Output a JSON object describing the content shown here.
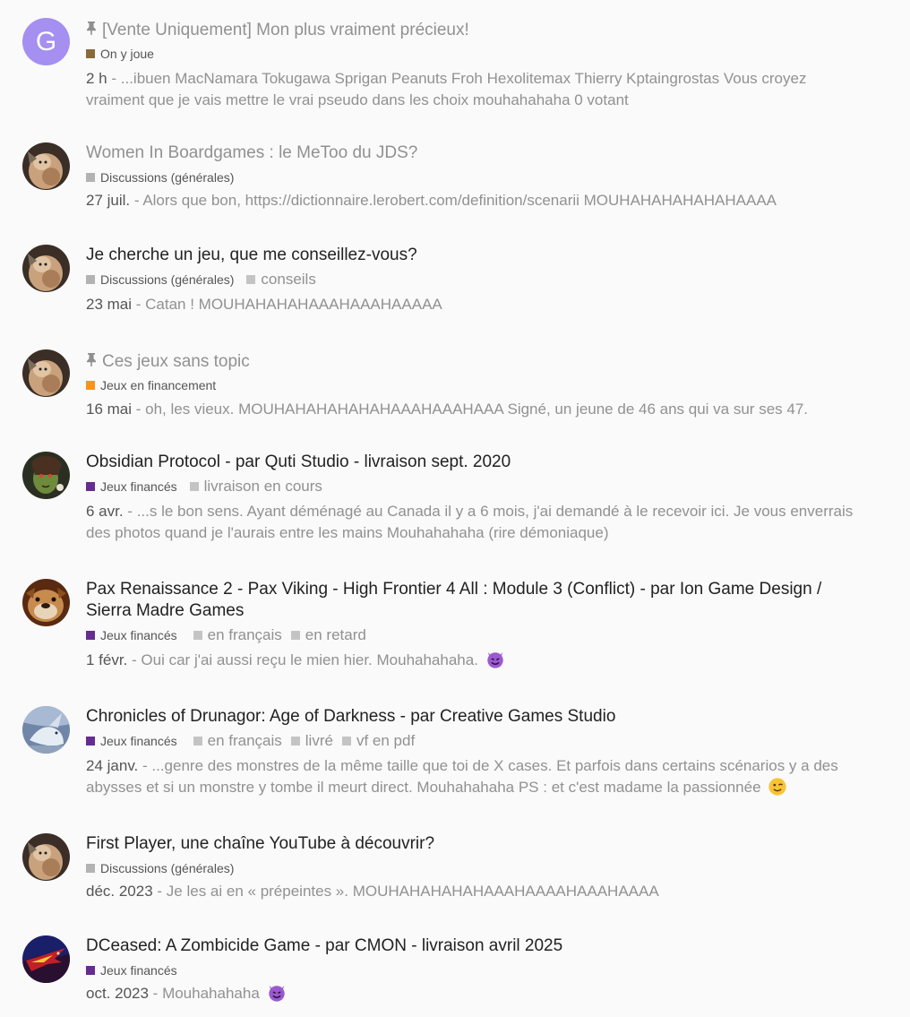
{
  "results": [
    {
      "avatar_letter": "G",
      "pinned": true,
      "title": "[Vente Uniquement] Mon plus vraiment précieux!",
      "visited": true,
      "category": {
        "label": "On y joue",
        "color": "#8a6a3b"
      },
      "tags": [],
      "date": "2 h",
      "excerpt": "...ibuen MacNamara Tokugawa Sprigan Peanuts Froh Hexolitemax Thierry Kptaingrostas Vous croyez vraiment que je vais mettre le vrai pseudo dans les choix mouhahahaha 0 votant"
    },
    {
      "avatar": "cat-avatar",
      "pinned": false,
      "title": "Women In Boardgames : le MeToo du JDS?",
      "visited": true,
      "category": {
        "label": "Discussions (générales)",
        "color": "#b3b3b3"
      },
      "tags": [],
      "date": "27 juil.",
      "excerpt": "Alors que bon, https://dictionnaire.lerobert.com/definition/scenarii MOUHAHAHAHAHAHAAAA"
    },
    {
      "avatar": "cat-avatar",
      "pinned": false,
      "title": "Je cherche un jeu, que me conseillez-vous?",
      "visited": false,
      "category": {
        "label": "Discussions (générales)",
        "color": "#b3b3b3"
      },
      "tags": [
        "conseils"
      ],
      "date": "23 mai",
      "excerpt": "Catan ! MOUHAHAHAHAAAHAAAHAAAAA"
    },
    {
      "avatar": "cat-avatar",
      "pinned": true,
      "title": "Ces jeux sans topic",
      "visited": true,
      "category": {
        "label": "Jeux en financement",
        "color": "#f7941d"
      },
      "tags": [],
      "date": "16 mai",
      "excerpt": "oh, les vieux. MOUHAHAHAHAHAHAAAHAAAHAAA Signé, un jeune de 46 ans qui va sur ses 47."
    },
    {
      "avatar": "goblin-avatar",
      "pinned": false,
      "title": "Obsidian Protocol - par Quti Studio - livraison sept. 2020",
      "visited": false,
      "category": {
        "label": "Jeux financés",
        "color": "#652d90"
      },
      "tags": [
        "livraison en cours"
      ],
      "date": "6 avr.",
      "excerpt": "...s le bon sens. Ayant déménagé au Canada il y a 6 mois, j'ai demandé à le recevoir ici. Je vous enverrais des photos quand je l'aurais entre les mains Mouhahahaha (rire démoniaque)"
    },
    {
      "avatar": "bulldog-avatar",
      "pinned": false,
      "title": "Pax Renaissance 2 - Pax Viking - High Frontier 4 All : Module 3 (Conflict) - par Ion Game Design / Sierra Madre Games",
      "visited": false,
      "category": {
        "label": "Jeux financés",
        "color": "#652d90"
      },
      "tags": [
        "en français",
        "en retard"
      ],
      "date": "1 févr.",
      "excerpt": "Oui car j'ai aussi reçu le mien hier. Mouhahahaha.",
      "emoji": "smiling-imp"
    },
    {
      "avatar": "dragon-white-avatar",
      "pinned": false,
      "title": "Chronicles of Drunagor: Age of Darkness - par Creative Games Studio",
      "visited": false,
      "category": {
        "label": "Jeux financés",
        "color": "#652d90"
      },
      "tags": [
        "en français",
        "livré",
        "vf en pdf"
      ],
      "date": "24 janv.",
      "excerpt": "...genre des monstres de la même taille que toi de X cases. Et parfois dans certains scénarios y a des abysses et si un monstre y tombe il meurt direct. Mouhahahaha PS : et c'est madame la passionnée",
      "emoji": "wink"
    },
    {
      "avatar": "cat-avatar",
      "pinned": false,
      "title": "First Player, une chaîne YouTube à découvrir?",
      "visited": false,
      "category": {
        "label": "Discussions (générales)",
        "color": "#b3b3b3"
      },
      "tags": [],
      "date": "déc. 2023",
      "excerpt": "Je les ai en « prépeintes ». MOUHAHAHAHAHAAAHAAAAHAAAHAAAA"
    },
    {
      "avatar": "red-dragon-avatar",
      "pinned": false,
      "title": "DCeased: A Zombicide Game - par CMON - livraison avril 2025",
      "visited": false,
      "category": {
        "label": "Jeux financés",
        "color": "#652d90"
      },
      "tags": [],
      "date": "oct. 2023",
      "excerpt": "Mouhahahaha",
      "emoji": "smiling-imp"
    }
  ]
}
